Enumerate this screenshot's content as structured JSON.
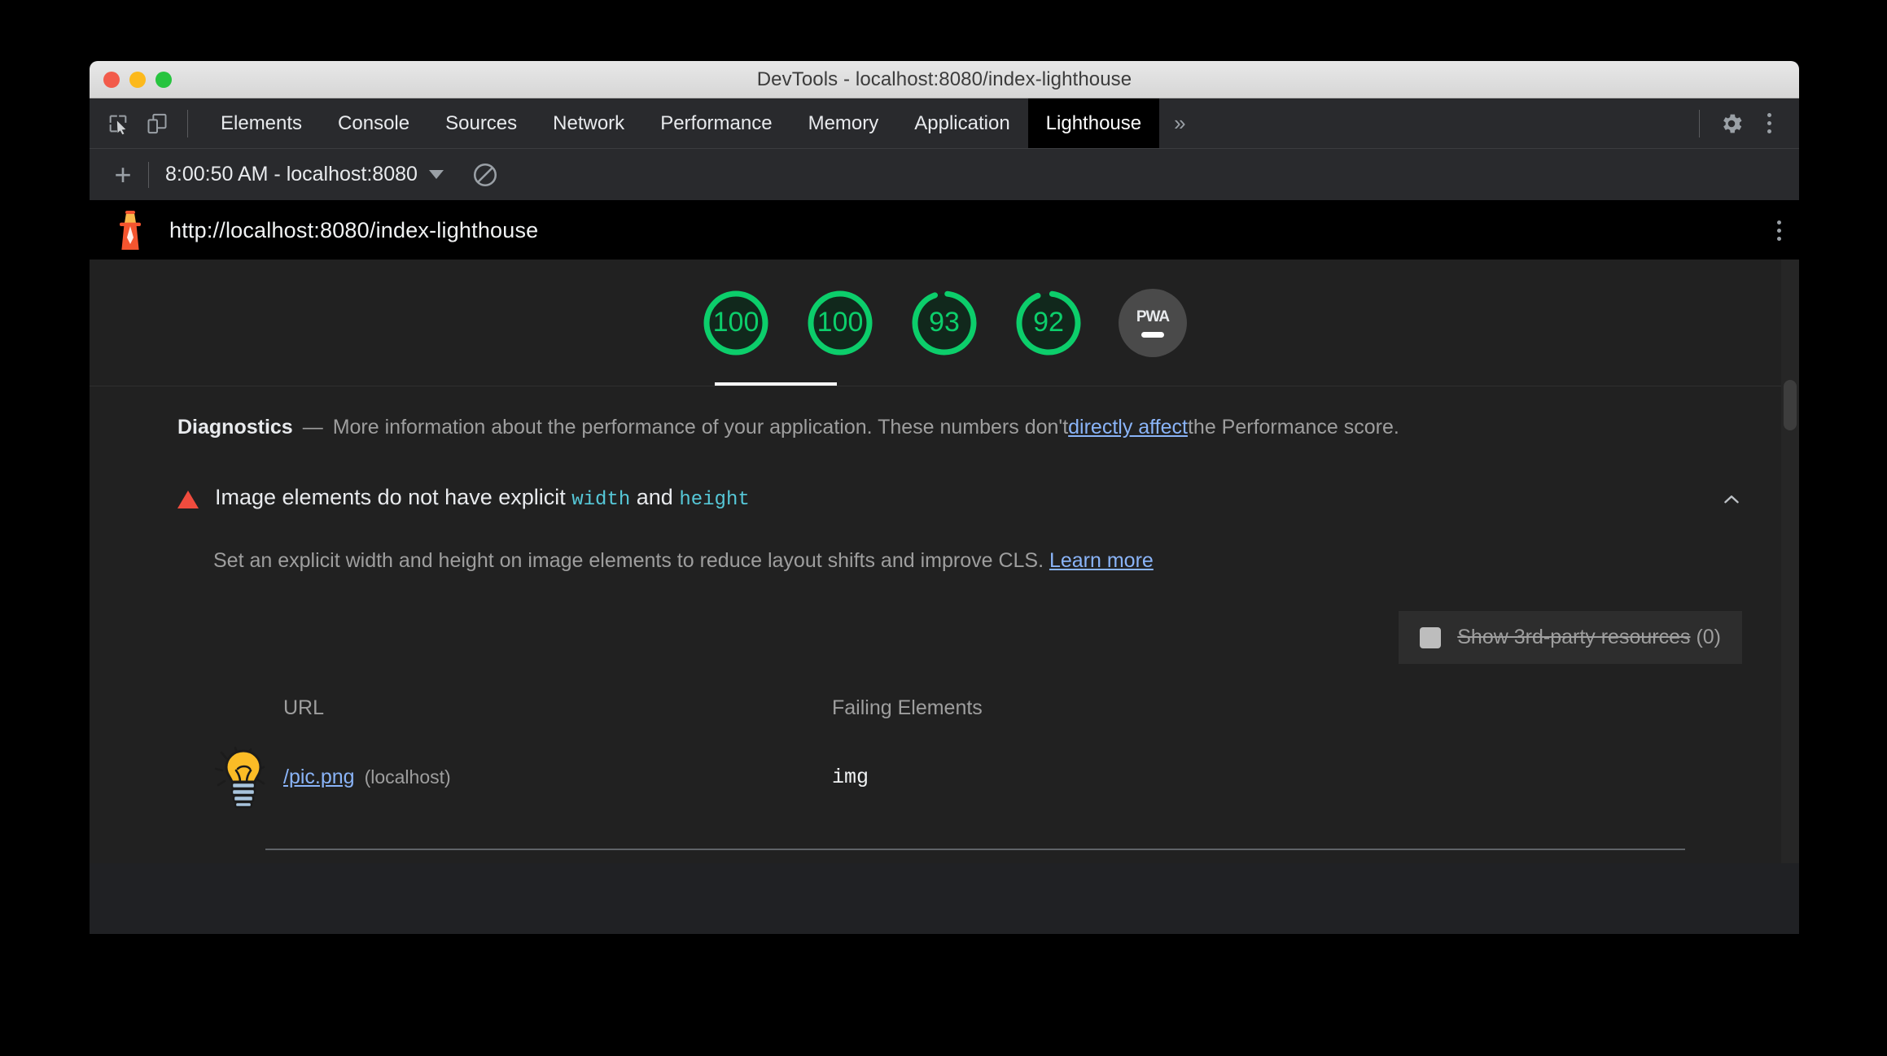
{
  "window": {
    "title": "DevTools - localhost:8080/index-lighthouse",
    "traffic_lights": [
      "close",
      "minimize",
      "maximize"
    ]
  },
  "tabbar": {
    "inspect_icon": "inspect-element-icon",
    "device_icon": "device-toolbar-icon",
    "tabs": [
      {
        "label": "Elements",
        "active": false
      },
      {
        "label": "Console",
        "active": false
      },
      {
        "label": "Sources",
        "active": false
      },
      {
        "label": "Network",
        "active": false
      },
      {
        "label": "Performance",
        "active": false
      },
      {
        "label": "Memory",
        "active": false
      },
      {
        "label": "Application",
        "active": false
      },
      {
        "label": "Lighthouse",
        "active": true
      }
    ],
    "more_tabs_label": "»",
    "settings_icon": "gear-icon",
    "menu_icon": "kebab-menu-icon"
  },
  "lighthouse_toolbar": {
    "add_label": "+",
    "run_selector_value": "8:00:50 AM - localhost:8080",
    "clear_icon": "clear-prohibited-icon"
  },
  "report_header": {
    "logo_icon": "lighthouse-logo-icon",
    "url": "http://localhost:8080/index-lighthouse",
    "menu_icon": "kebab-menu-icon"
  },
  "scores": {
    "gauges": [
      {
        "value": "100",
        "score": 100,
        "selected": true
      },
      {
        "value": "100",
        "score": 100,
        "selected": false
      },
      {
        "value": "93",
        "score": 93,
        "selected": false
      },
      {
        "value": "92",
        "score": 92,
        "selected": false
      }
    ],
    "pwa": {
      "label": "PWA",
      "state": "not-applicable"
    },
    "pass_color": "#0cce6b"
  },
  "diagnostics": {
    "title": "Diagnostics",
    "dash": "—",
    "text_before_link": "More information about the performance of your application. These numbers don't ",
    "link_label": "directly affect",
    "text_after_link": " the Performance score."
  },
  "audit": {
    "severity_icon": "warning-triangle-icon",
    "title_part1": "Image elements do not have explicit ",
    "title_code1": "width",
    "title_part2": " and ",
    "title_code2": "height",
    "collapse_icon": "chevron-up-icon",
    "description": "Set an explicit width and height on image elements to reduce layout shifts and improve CLS. ",
    "learn_more_label": "Learn more",
    "third_party": {
      "checkbox_state": "unchecked",
      "label": "Show 3rd-party resources",
      "count": "(0)"
    },
    "table": {
      "columns": [
        "URL",
        "Failing Elements"
      ],
      "rows": [
        {
          "thumbnail_icon": "lightbulb-thumbnail-icon",
          "url": "/pic.png",
          "host": "(localhost)",
          "failing_element": "img"
        }
      ]
    }
  }
}
